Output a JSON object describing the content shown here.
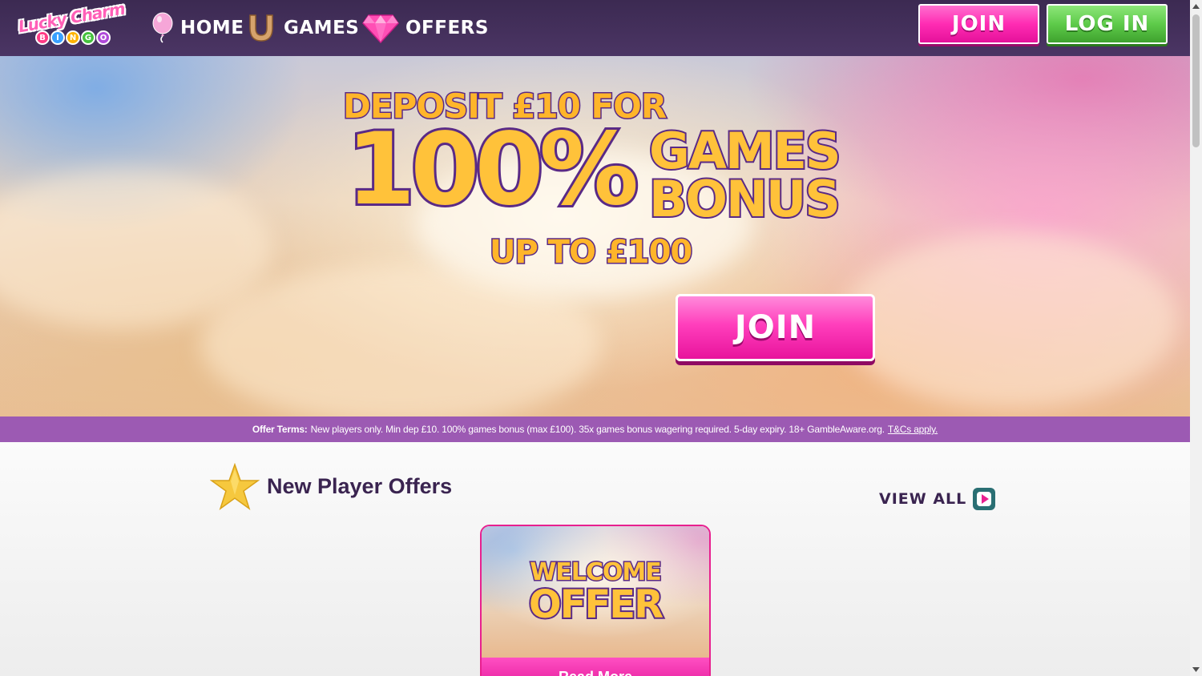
{
  "header": {
    "logo": {
      "line1": "Lucky Charm",
      "balls": [
        "B",
        "I",
        "N",
        "G",
        "O"
      ]
    },
    "nav": [
      {
        "label": "HOME",
        "icon": "balloon-icon"
      },
      {
        "label": "GAMES",
        "icon": "horseshoe-icon"
      },
      {
        "label": "OFFERS",
        "icon": "diamond-icon"
      }
    ],
    "join_label": "JOIN",
    "login_label": "LOG IN"
  },
  "hero": {
    "line1": "DEPOSIT £10 FOR",
    "big": "100%",
    "games": "GAMES",
    "bonus": "BONUS",
    "upto": "UP TO £100",
    "join_label": "JOIN"
  },
  "terms": {
    "heading": "Offer Terms:",
    "text": "New players only. Min dep £10. 100% games bonus (max £100). 35x games bonus wagering required. 5-day expiry. 18+ GambleAware.org.",
    "link": "T&Cs apply."
  },
  "section": {
    "title": "New Player Offers",
    "view_all": "VIEW ALL",
    "card": {
      "line1": "WELCOME",
      "line2": "OFFER",
      "button": "Read More"
    }
  },
  "colors": {
    "header_bg": "#3c2a52",
    "join_pink": "#ff2cb3",
    "login_green": "#5ecb4a",
    "terms_bg": "#9c5ab3",
    "title_purple": "#3a2450",
    "headline_gold": "#ffc23a"
  }
}
